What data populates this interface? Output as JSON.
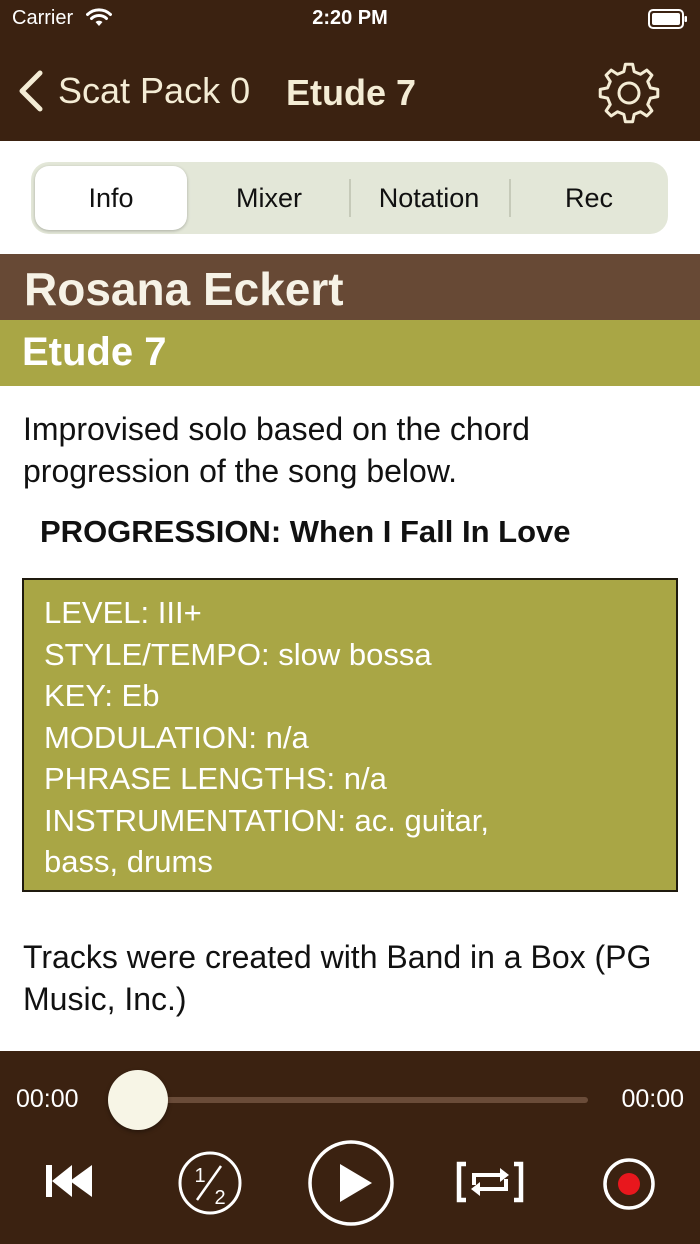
{
  "status": {
    "carrier": "Carrier",
    "time": "2:20 PM"
  },
  "nav": {
    "back_label": "Scat Pack 0",
    "title": "Etude 7"
  },
  "tabs": [
    {
      "label": "Info",
      "selected": true
    },
    {
      "label": "Mixer",
      "selected": false
    },
    {
      "label": "Notation",
      "selected": false
    },
    {
      "label": "Rec",
      "selected": false
    }
  ],
  "composer": "Rosana Eckert",
  "etude": "Etude 7",
  "description": "Improvised solo based on the chord progression of the song below.",
  "progression": "PROGRESSION: When I Fall In Love",
  "details": [
    "LEVEL: III+",
    "STYLE/TEMPO: slow bossa",
    "KEY: Eb",
    "MODULATION: n/a",
    "PHRASE LENGTHS: n/a",
    "INSTRUMENTATION: ac. guitar,\nbass, drums"
  ],
  "credit": "Tracks were created with Band in a Box (PG Music, Inc.)",
  "player": {
    "elapsed": "00:00",
    "total": "00:00",
    "progress": 0,
    "controls": [
      "rewind-to-start",
      "half-speed",
      "play",
      "loop",
      "record"
    ]
  },
  "colors": {
    "bar_brown": "#3b2211",
    "composer_brown": "#674935",
    "olive": "#a9a645",
    "record_red": "#e8171d",
    "segment_bg": "#e3e7d8"
  }
}
